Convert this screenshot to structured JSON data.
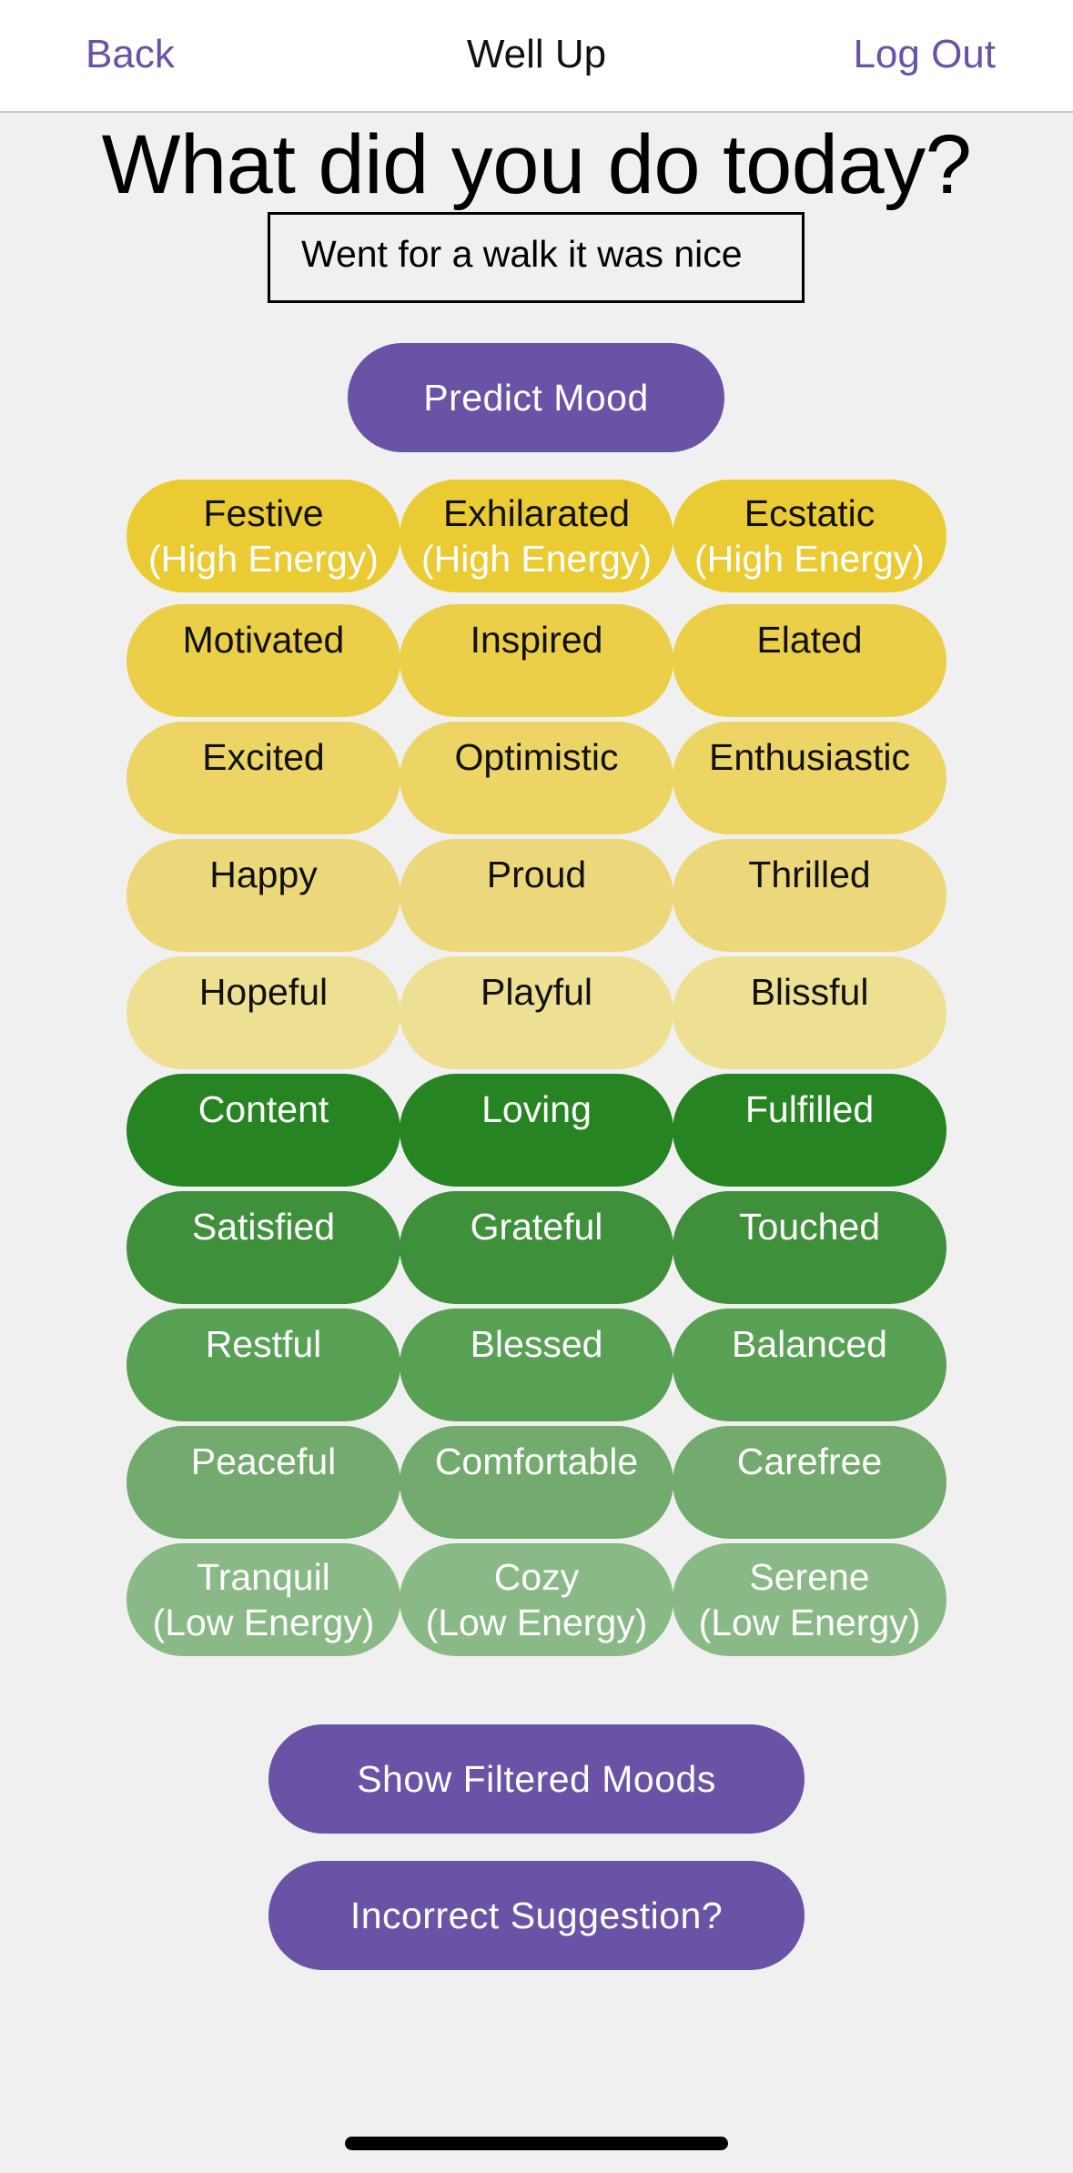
{
  "nav": {
    "back_label": "Back",
    "title": "Well Up",
    "logout_label": "Log Out"
  },
  "main": {
    "heading": "What did you do today?",
    "entry_text": "Went for a walk it was nice",
    "predict_label": "Predict Mood",
    "filter_label": "Show Filtered Moods",
    "incorrect_label": "Incorrect Suggestion?"
  },
  "moods": [
    {
      "colors": {
        "bg": "#ebcb33",
        "text": "dark"
      },
      "items": [
        {
          "label": "Festive",
          "sub": "(High Energy)"
        },
        {
          "label": "Exhilarated",
          "sub": "(High Energy)"
        },
        {
          "label": "Ecstatic",
          "sub": "(High Energy)"
        }
      ]
    },
    {
      "colors": {
        "bg": "#ebcf48",
        "text": "dark"
      },
      "items": [
        {
          "label": "Motivated"
        },
        {
          "label": "Inspired"
        },
        {
          "label": "Elated"
        }
      ]
    },
    {
      "colors": {
        "bg": "#ecd465",
        "text": "dark"
      },
      "items": [
        {
          "label": "Excited"
        },
        {
          "label": "Optimistic"
        },
        {
          "label": "Enthusiastic"
        }
      ]
    },
    {
      "colors": {
        "bg": "#ecd87a",
        "text": "dark"
      },
      "items": [
        {
          "label": "Happy"
        },
        {
          "label": "Proud"
        },
        {
          "label": "Thrilled"
        }
      ]
    },
    {
      "colors": {
        "bg": "#ede093",
        "text": "dark"
      },
      "items": [
        {
          "label": "Hopeful"
        },
        {
          "label": "Playful"
        },
        {
          "label": "Blissful"
        }
      ]
    },
    {
      "colors": {
        "bg": "#268522",
        "text": "light"
      },
      "items": [
        {
          "label": "Content"
        },
        {
          "label": "Loving"
        },
        {
          "label": "Fulfilled"
        }
      ]
    },
    {
      "colors": {
        "bg": "#3f903b",
        "text": "light"
      },
      "items": [
        {
          "label": "Satisfied"
        },
        {
          "label": "Grateful"
        },
        {
          "label": "Touched"
        }
      ]
    },
    {
      "colors": {
        "bg": "#58a054",
        "text": "light"
      },
      "items": [
        {
          "label": "Restful"
        },
        {
          "label": "Blessed"
        },
        {
          "label": "Balanced"
        }
      ]
    },
    {
      "colors": {
        "bg": "#72ab6d",
        "text": "light"
      },
      "items": [
        {
          "label": "Peaceful"
        },
        {
          "label": "Comfortable"
        },
        {
          "label": "Carefree"
        }
      ]
    },
    {
      "colors": {
        "bg": "#89b986",
        "text": "light"
      },
      "items": [
        {
          "label": "Tranquil",
          "sub": "(Low Energy)"
        },
        {
          "label": "Cozy",
          "sub": "(Low Energy)"
        },
        {
          "label": "Serene",
          "sub": "(Low Energy)"
        }
      ]
    }
  ],
  "colors": {
    "accent": "#6a52a6",
    "background": "#f0f0f0"
  }
}
